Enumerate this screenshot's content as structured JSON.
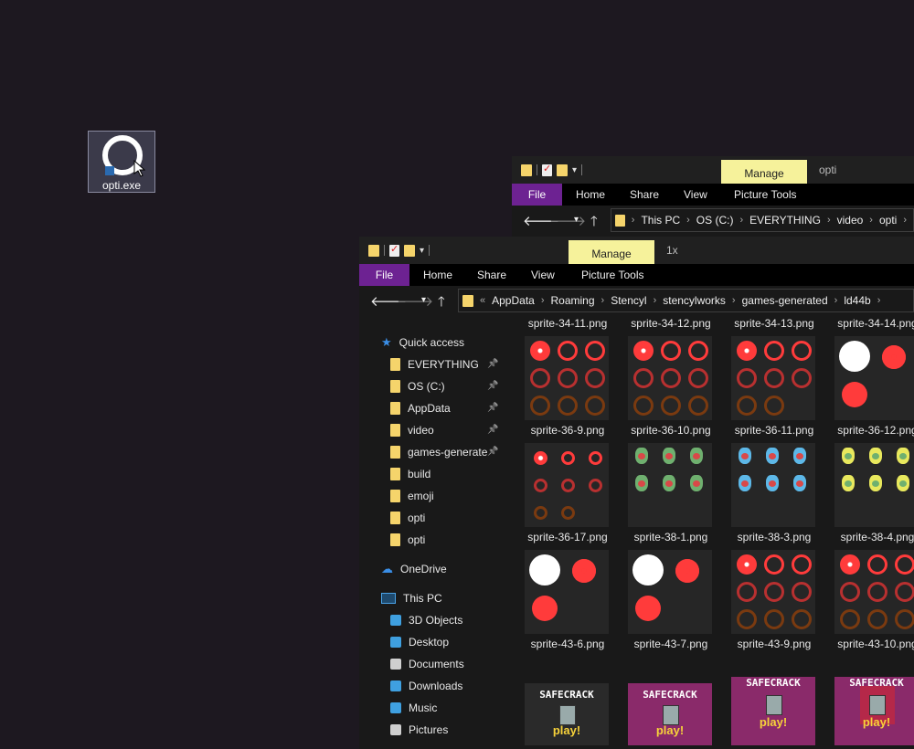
{
  "desktop": {
    "icon_label": "opti.exe"
  },
  "back_window": {
    "manage_label": "Manage",
    "title": "opti",
    "tabs": [
      "File",
      "Home",
      "Share",
      "View",
      "Picture Tools"
    ],
    "breadcrumb": [
      "This PC",
      "OS (C:)",
      "EVERYTHING",
      "video",
      "opti"
    ]
  },
  "front_window": {
    "manage_label": "Manage",
    "title": "1x",
    "tabs": [
      "File",
      "Home",
      "Share",
      "View",
      "Picture Tools"
    ],
    "breadcrumb_prefix": "«",
    "breadcrumb": [
      "AppData",
      "Roaming",
      "Stencyl",
      "stencylworks",
      "games-generated",
      "ld44b"
    ],
    "nav": {
      "quick_access": "Quick access",
      "quick_items": [
        {
          "label": "EVERYTHING",
          "pinned": true
        },
        {
          "label": "OS (C:)",
          "pinned": true
        },
        {
          "label": "AppData",
          "pinned": true
        },
        {
          "label": "video",
          "pinned": true
        },
        {
          "label": "games-generate",
          "pinned": true
        },
        {
          "label": "build",
          "pinned": false
        },
        {
          "label": "emoji",
          "pinned": false
        },
        {
          "label": "opti",
          "pinned": false
        },
        {
          "label": "opti",
          "pinned": false
        }
      ],
      "onedrive": "OneDrive",
      "this_pc": "This PC",
      "pc_items": [
        "3D Objects",
        "Desktop",
        "Documents",
        "Downloads",
        "Music",
        "Pictures"
      ]
    },
    "files_top_row": [
      "sprite-34-11.png",
      "sprite-34-12.png",
      "sprite-34-13.png",
      "sprite-34-14.png"
    ],
    "files_row1": [
      "sprite-36-9.png",
      "sprite-36-10.png",
      "sprite-36-11.png",
      "sprite-36-12.png"
    ],
    "files_row2": [
      "sprite-36-17.png",
      "sprite-38-1.png",
      "sprite-38-3.png",
      "sprite-38-4.png"
    ],
    "files_row3": [
      "sprite-43-6.png",
      "sprite-43-7.png",
      "sprite-43-9.png",
      "sprite-43-10.png"
    ],
    "safe_title": "SAFECRACK",
    "safe_play": "play!"
  },
  "colors": {
    "accent_file": "#6d2292",
    "manage_bg": "#f6f29b",
    "folder": "#f5d46b",
    "sprite_red": "#ff3b3b"
  }
}
